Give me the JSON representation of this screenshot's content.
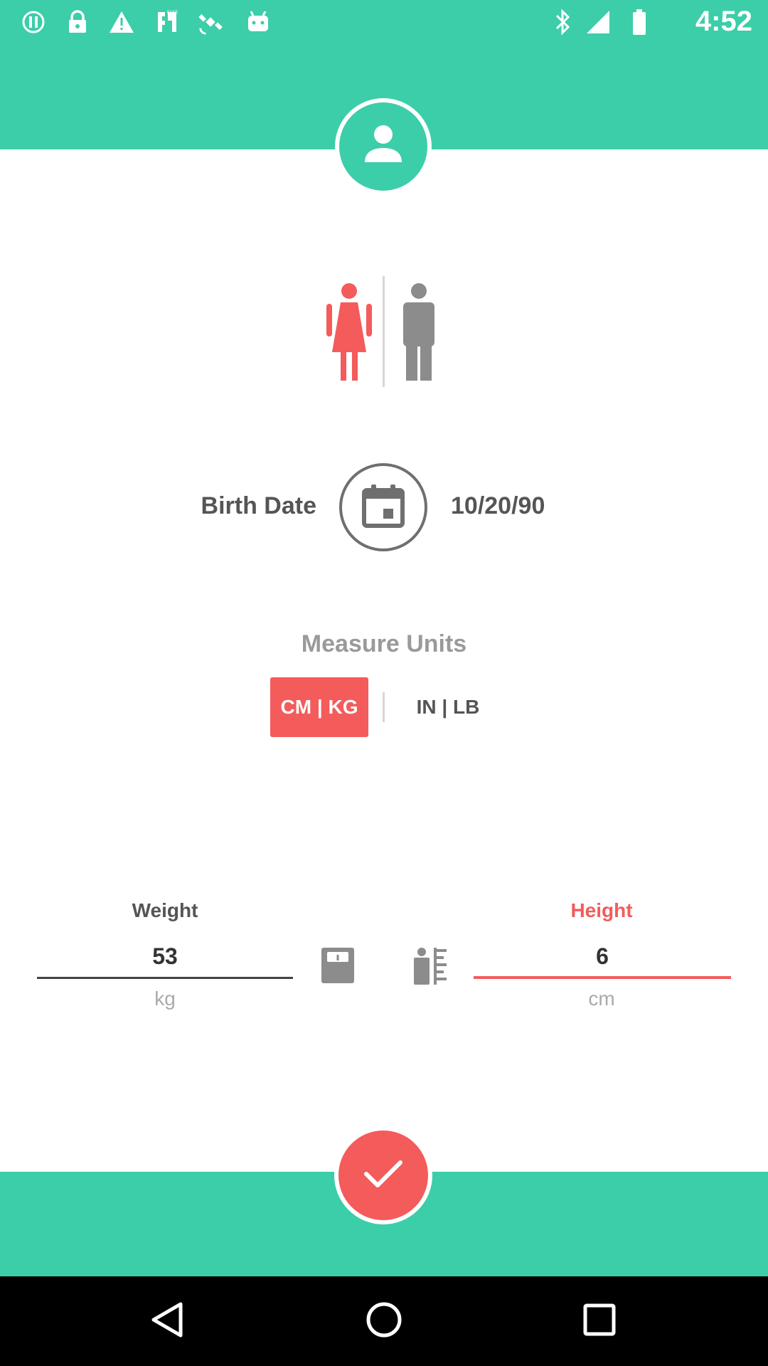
{
  "status_bar": {
    "time": "4:52",
    "icons": [
      "data-saver-icon",
      "lock-icon",
      "warning-icon",
      "fake-gps-icon",
      "satellite-icon",
      "android-icon",
      "bluetooth-icon",
      "signal-icon",
      "battery-icon"
    ]
  },
  "profile": {
    "avatar_icon": "person-icon",
    "gender": {
      "selected": "female",
      "options": [
        "female",
        "male"
      ],
      "female_color": "#f45b5b",
      "male_color": "#8c8c8c"
    },
    "birth_date": {
      "label": "Birth Date",
      "value": "10/20/90",
      "icon": "calendar-icon"
    },
    "measure_units": {
      "title": "Measure Units",
      "options": [
        "CM | KG",
        "IN | LB"
      ],
      "selected": "CM | KG"
    },
    "weight": {
      "label": "Weight",
      "value": "53",
      "unit": "kg",
      "icon": "scale-icon"
    },
    "height": {
      "label": "Height",
      "value": "6",
      "unit": "cm",
      "icon": "ruler-icon"
    },
    "confirm_icon": "checkmark-icon"
  },
  "colors": {
    "accent": "#3bcea9",
    "highlight": "#f45b5b",
    "text": "#555555",
    "muted": "#9a9a9a"
  },
  "nav_bar": {
    "buttons": [
      "back-icon",
      "home-icon",
      "recents-icon"
    ]
  }
}
